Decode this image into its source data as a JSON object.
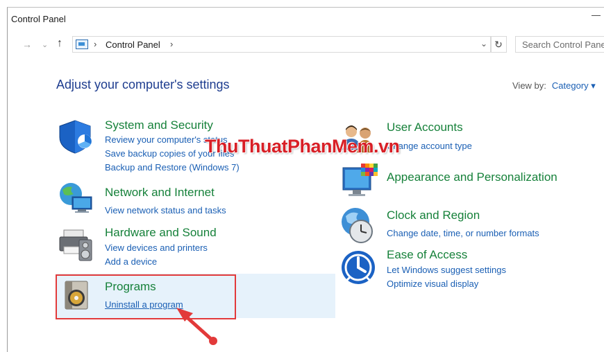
{
  "window": {
    "title": "Control Panel"
  },
  "nav": {
    "back": "→",
    "dropdown": "⌄",
    "up": "↑",
    "breadcrumb": "Control Panel",
    "separator": "›",
    "search_placeholder": "Search Control Panel"
  },
  "header": {
    "heading": "Adjust your computer's settings",
    "view_by_label": "View by:",
    "view_by_value": "Category ▾"
  },
  "categories": {
    "system": {
      "title": "System and Security",
      "links": [
        "Review your computer's status",
        "Save backup copies of your files",
        "Backup and Restore (Windows 7)"
      ]
    },
    "network": {
      "title": "Network and Internet",
      "links": [
        "View network status and tasks"
      ]
    },
    "hardware": {
      "title": "Hardware and Sound",
      "links": [
        "View devices and printers",
        "Add a device"
      ]
    },
    "programs": {
      "title": "Programs",
      "links": [
        "Uninstall a program"
      ]
    },
    "users": {
      "title": "User Accounts",
      "links": [
        "Change account type"
      ]
    },
    "appearance": {
      "title": "Appearance and Personalization"
    },
    "clock": {
      "title": "Clock and Region",
      "links": [
        "Change date, time, or number formats"
      ]
    },
    "ease": {
      "title": "Ease of Access",
      "links": [
        "Let Windows suggest settings",
        "Optimize visual display"
      ]
    }
  },
  "watermark": "ThuThuatPhanMem.vn",
  "colors": {
    "category_green": "#16813a",
    "link_blue": "#1a5fb4",
    "heading_blue": "#1e3d8f",
    "highlight": "#e6f2fb",
    "annotation_red": "#e23a3a"
  }
}
